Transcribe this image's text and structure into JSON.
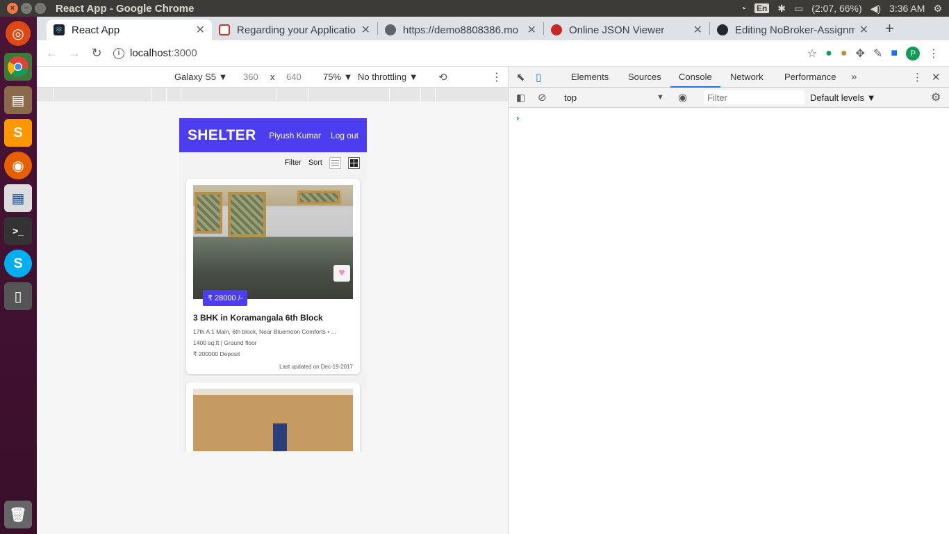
{
  "system": {
    "window_title": "React App - Google Chrome",
    "keyboard": "En",
    "battery": "(2:07, 66%)",
    "clock": "3:36 AM"
  },
  "tabs": [
    {
      "title": "React App",
      "favicon_color": "#61dafb",
      "active": true
    },
    {
      "title": "Regarding your Applicatio",
      "favicon_color": "#d93025",
      "active": false
    },
    {
      "title": "https://demo8808386.mo",
      "favicon_color": "#5f6368",
      "active": false
    },
    {
      "title": "Online JSON Viewer",
      "favicon_color": "#c62828",
      "active": false
    },
    {
      "title": "Editing NoBroker-Assignm",
      "favicon_color": "#24292e",
      "active": false
    }
  ],
  "omnibox": {
    "host": "localhost",
    "port": ":3000"
  },
  "device_toolbar": {
    "device": "Galaxy S5 ▼",
    "width": "360",
    "sep": "x",
    "height": "640",
    "zoom": "75% ▼",
    "throttling": "No throttling ▼"
  },
  "app": {
    "brand": "SHELTER",
    "user": "Piyush Kumar",
    "logout": "Log out",
    "filter": "Filter",
    "sort": "Sort",
    "accent": "#4c3df1",
    "listings": [
      {
        "price": "₹ 28000 /-",
        "title": "3 BHK in Koramangala 6th Block",
        "address": "17th A 1 Main, 6th block, Near Bluemoon Comforts • ...",
        "area": "1400 sq.ft | Ground floor",
        "deposit": "₹ 200000 Deposit",
        "updated": "Last updated on Dec-19-2017"
      }
    ]
  },
  "devtools": {
    "tabs": [
      "Elements",
      "Sources",
      "Console",
      "Network",
      "Performance"
    ],
    "active_tab": "Console",
    "context": "top",
    "filter_placeholder": "Filter",
    "levels": "Default levels ▼",
    "prompt": "›"
  }
}
